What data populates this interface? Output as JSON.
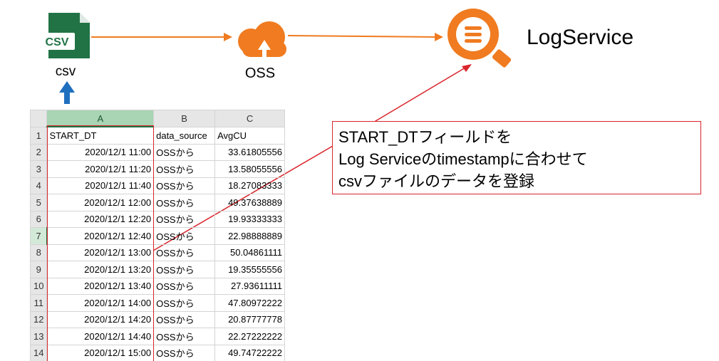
{
  "flow": {
    "csv_icon_text": "CSV",
    "csv_label": "csv",
    "oss_label": "OSS",
    "logservice_label": "LogService"
  },
  "colors": {
    "orange": "#f07b20",
    "arrow_up": "#1f6fbf",
    "csv_green": "#217346",
    "callout_border": "#d9262c",
    "highlight_border": "#d9262c"
  },
  "sheet": {
    "columns": [
      "A",
      "B",
      "C"
    ],
    "rows": [
      {
        "n": "1",
        "a": "START_DT",
        "b": "data_source",
        "c": "AvgCU"
      },
      {
        "n": "2",
        "a": "2020/12/1 11:00",
        "b": "OSSから",
        "c": "33.61805556"
      },
      {
        "n": "3",
        "a": "2020/12/1 11:20",
        "b": "OSSから",
        "c": "13.58055556"
      },
      {
        "n": "4",
        "a": "2020/12/1 11:40",
        "b": "OSSから",
        "c": "18.27083333"
      },
      {
        "n": "5",
        "a": "2020/12/1 12:00",
        "b": "OSSから",
        "c": "49.37638889"
      },
      {
        "n": "6",
        "a": "2020/12/1 12:20",
        "b": "OSSから",
        "c": "19.93333333"
      },
      {
        "n": "7",
        "a": "2020/12/1 12:40",
        "b": "OSSから",
        "c": "22.98888889"
      },
      {
        "n": "8",
        "a": "2020/12/1 13:00",
        "b": "OSSから",
        "c": "50.04861111"
      },
      {
        "n": "9",
        "a": "2020/12/1 13:20",
        "b": "OSSから",
        "c": "19.35555556"
      },
      {
        "n": "10",
        "a": "2020/12/1 13:40",
        "b": "OSSから",
        "c": "27.93611111"
      },
      {
        "n": "11",
        "a": "2020/12/1 14:00",
        "b": "OSSから",
        "c": "47.80972222"
      },
      {
        "n": "12",
        "a": "2020/12/1 14:20",
        "b": "OSSから",
        "c": "20.87777778"
      },
      {
        "n": "13",
        "a": "2020/12/1 14:40",
        "b": "OSSから",
        "c": "22.27222222"
      },
      {
        "n": "14",
        "a": "2020/12/1 15:00",
        "b": "OSSから",
        "c": "49.74722222"
      }
    ]
  },
  "callout": {
    "lines": [
      "START_DTフィールドを",
      "Log Serviceのtimestampに合わせて",
      "csvファイルのデータを登録"
    ]
  }
}
